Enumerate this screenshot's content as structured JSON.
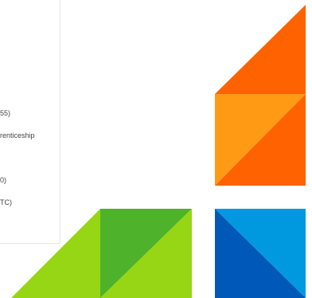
{
  "sidebar": {
    "fragments": [
      "55)",
      "renticeship",
      "0)",
      "TC)"
    ]
  },
  "colors": {
    "orange_dark": "#ff6200",
    "orange_light": "#ff9a14",
    "green_dark": "#4eb22b",
    "green_light": "#96d614",
    "blue_light": "#0099e0",
    "blue_dark": "#0058b8"
  },
  "decor": [
    "orange-tile",
    "green-tile",
    "blue-tile"
  ]
}
